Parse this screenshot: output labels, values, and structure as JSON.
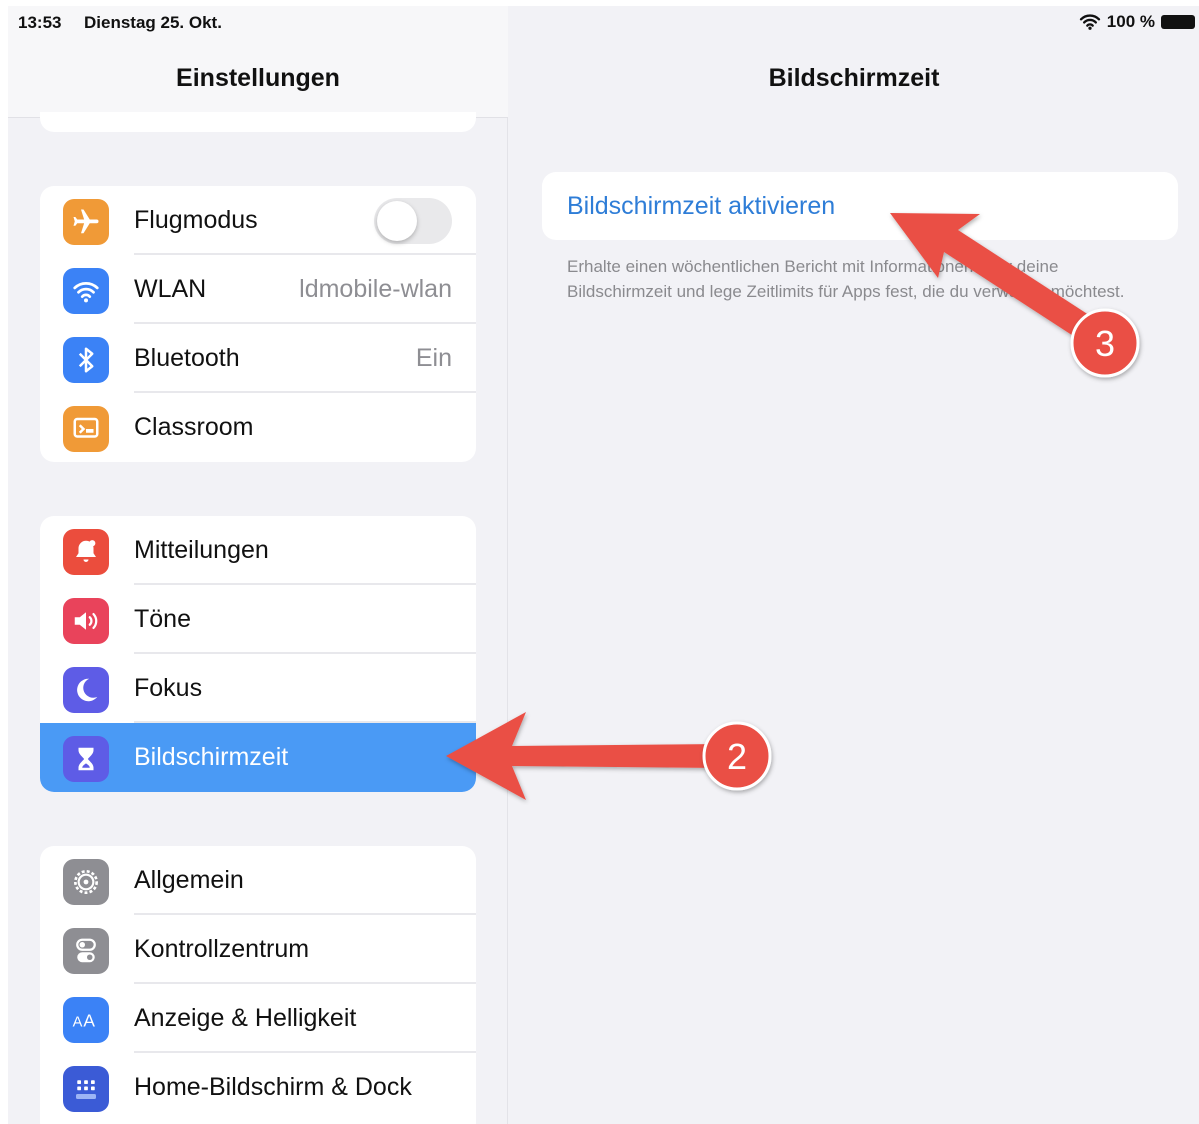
{
  "status_bar": {
    "time": "13:53",
    "date": "Dienstag 25. Okt.",
    "battery": "100 %"
  },
  "sidebar": {
    "title": "Einstellungen",
    "group1": [
      {
        "label": "Flugmodus",
        "icon": "airplane-icon",
        "color": "#f09a37"
      },
      {
        "label": "WLAN",
        "value": "ldmobile-wlan",
        "icon": "wifi-icon",
        "color": "#3b82f6"
      },
      {
        "label": "Bluetooth",
        "value": "Ein",
        "icon": "bluetooth-icon",
        "color": "#3b82f6"
      },
      {
        "label": "Classroom",
        "icon": "classroom-icon",
        "color": "#f09a37"
      }
    ],
    "group2": [
      {
        "label": "Mitteilungen",
        "icon": "notification-bell-icon",
        "color": "#eb4d3d"
      },
      {
        "label": "Töne",
        "icon": "speaker-icon",
        "color": "#e9435b"
      },
      {
        "label": "Fokus",
        "icon": "moon-icon",
        "color": "#5e5ce6"
      },
      {
        "label": "Bildschirmzeit",
        "icon": "hourglass-icon",
        "color": "#5e5ce6",
        "selected": true
      }
    ],
    "group3": [
      {
        "label": "Allgemein",
        "icon": "gear-icon",
        "color": "#8e8e93"
      },
      {
        "label": "Kontrollzentrum",
        "icon": "toggles-icon",
        "color": "#8e8e93"
      },
      {
        "label": "Anzeige & Helligkeit",
        "icon": "text-size-icon",
        "color": "#3b82f6"
      },
      {
        "label": "Home-Bildschirm & Dock",
        "icon": "home-screen-icon",
        "color": "#3b5bd6"
      }
    ]
  },
  "main": {
    "title": "Bildschirmzeit",
    "activate_label": "Bildschirmzeit aktivieren",
    "description": "Erhalte einen wöchentlichen Bericht mit Informationen über deine Bildschirmzeit und lege Zeitlimits für Apps fest, die du verwalten möchtest."
  },
  "annotations": {
    "badge_2": "2",
    "badge_3": "3",
    "accent": "#ea4f45"
  }
}
